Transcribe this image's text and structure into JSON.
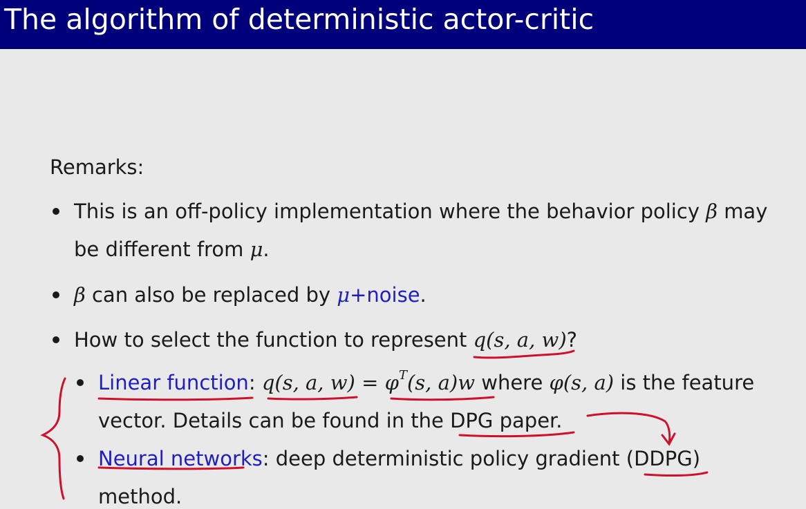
{
  "title": "The algorithm of deterministic actor-critic",
  "remarks_label": "Remarks:",
  "bullet1": {
    "line1_a": "This is an off-policy implementation where the behavior policy",
    "beta": "β",
    "line1_b": "may",
    "line2_a": "be different from",
    "mu": "μ",
    "line2_b": "."
  },
  "bullet2": {
    "beta": "β",
    "text": "can also be replaced by",
    "mu_noise_mu": "μ",
    "mu_noise_plus": "+",
    "mu_noise_word": "noise",
    "period": "."
  },
  "bullet3": {
    "text": "How to select the function to represent",
    "q": "q(s, a, w)",
    "end": "?"
  },
  "sub1": {
    "label": "Linear function",
    "colon": ":",
    "lhs": "q(s, a, w)",
    "eq": "=",
    "phi": "φ",
    "sup": "T",
    "phi_args": "(s, a)w",
    "where": "where",
    "phi2": "φ(s, a)",
    "rest": "is the feature",
    "line2": "vector. Details can be found in the DPG paper."
  },
  "sub2": {
    "label": "Neural networks",
    "text": ": deep deterministic policy gradient (DDPG)",
    "line2": "method."
  },
  "colors": {
    "title_bar": "#00007a",
    "link_blue": "#1f1fbf",
    "ink_red": "#d0102a",
    "background": "#e9e9e9"
  }
}
